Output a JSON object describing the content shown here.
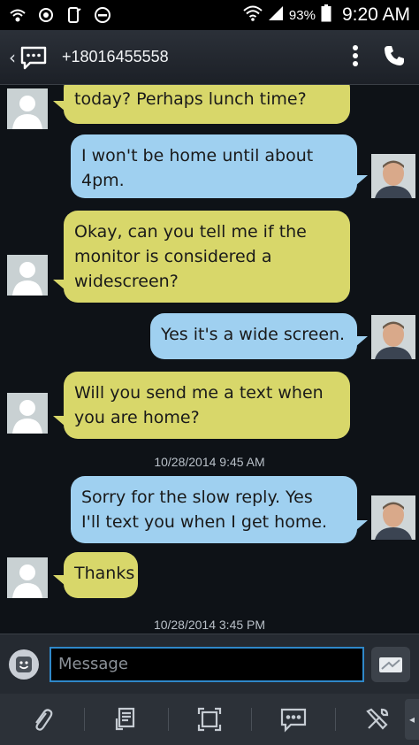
{
  "status_bar": {
    "battery_percent": "93%",
    "time": "9:20 AM",
    "icons": [
      "wifi-calling-icon",
      "sync-icon",
      "s-beam-icon",
      "do-not-disturb-icon",
      "wifi-icon",
      "signal-icon",
      "battery-icon"
    ]
  },
  "header": {
    "contact": "+18016455558",
    "icons": [
      "back-chevron-icon",
      "messages-app-icon",
      "more-vert-icon",
      "phone-icon"
    ]
  },
  "conversation": {
    "messages": [
      {
        "direction": "in",
        "lines": [
          "today? Perhaps lunch time?"
        ]
      },
      {
        "direction": "out",
        "lines": [
          "I won't be home until about",
          "4pm."
        ]
      },
      {
        "direction": "in",
        "lines": [
          "Okay, can you tell me if the",
          "monitor is considered a",
          "widescreen?"
        ]
      },
      {
        "direction": "out",
        "lines": [
          "Yes it's a wide screen."
        ]
      },
      {
        "direction": "in",
        "lines": [
          "Will you send me a text when",
          "you are home?"
        ]
      },
      {
        "direction": "out",
        "lines": [
          "Sorry for the slow reply.  Yes",
          "I'll text you when I get home."
        ]
      },
      {
        "direction": "in",
        "lines": [
          "Thanks"
        ]
      }
    ],
    "timestamps": [
      "10/28/2014 9:45 AM",
      "10/28/2014 3:45 PM"
    ]
  },
  "composer": {
    "placeholder": "Message",
    "value": ""
  },
  "toolbar": {
    "items": [
      "attach-icon",
      "message-template-icon",
      "screen-capture-icon",
      "chat-bubble-icon",
      "settings-tools-icon"
    ]
  },
  "colors": {
    "incoming_bubble": "#d8d76a",
    "outgoing_bubble": "#9fd0f0",
    "background": "#0e1217",
    "input_border": "#2f88c9"
  }
}
